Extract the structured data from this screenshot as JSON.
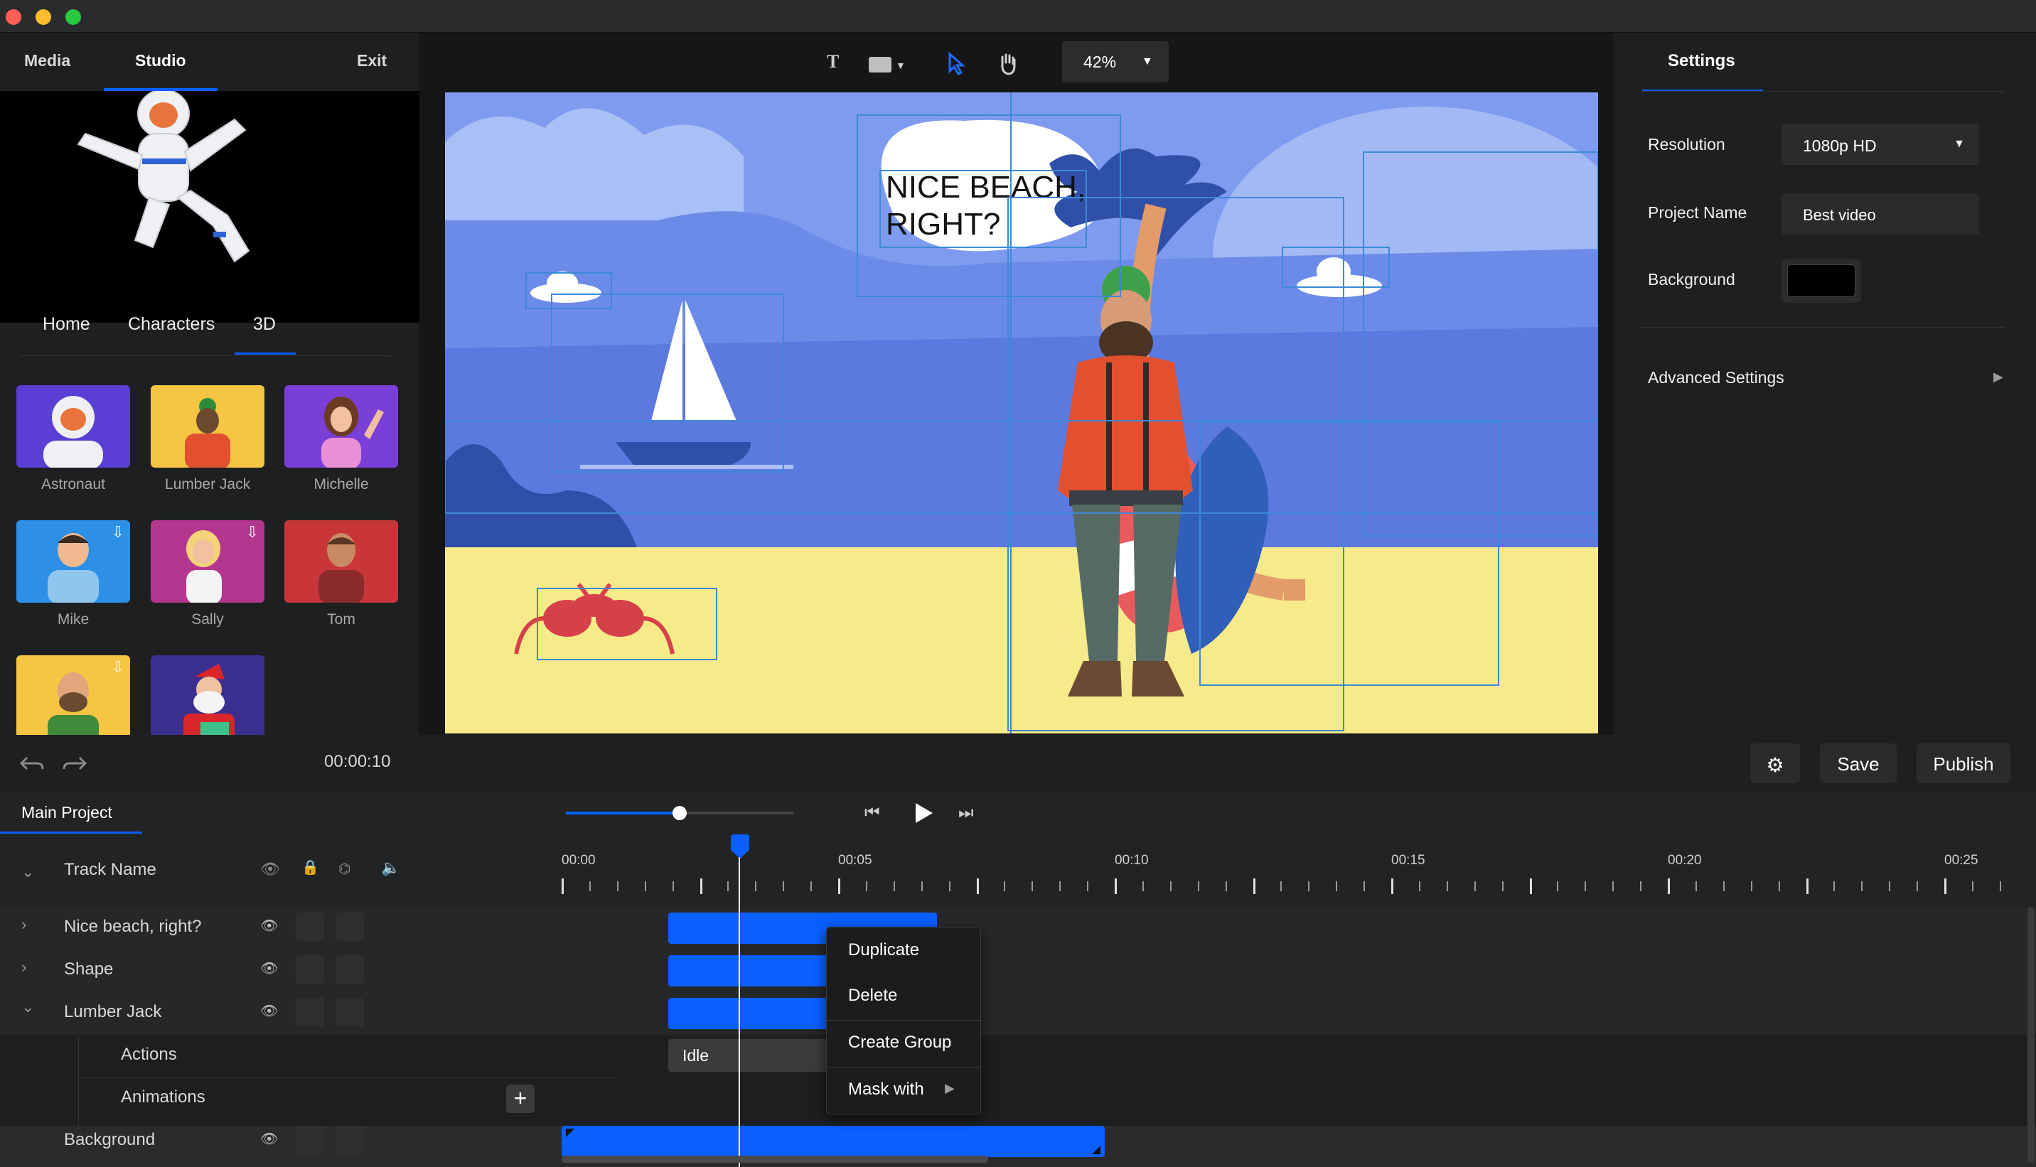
{
  "window": {
    "traffic_lights": [
      "#fe5f57",
      "#febc2e",
      "#28c840"
    ]
  },
  "left_nav": {
    "media": "Media",
    "studio": "Studio",
    "exit": "Exit"
  },
  "library_tabs": [
    "Home",
    "Characters",
    "3D"
  ],
  "characters": [
    {
      "name": "Astronaut",
      "bg": "#5b3fd4",
      "download": false
    },
    {
      "name": "Lumber Jack",
      "bg": "#f6c543",
      "download": false
    },
    {
      "name": "Michelle",
      "bg": "#7a3fd6",
      "download": false
    },
    {
      "name": "Mike",
      "bg": "#2d8fe6",
      "download": true
    },
    {
      "name": "Sally",
      "bg": "#b3368f",
      "download": true
    },
    {
      "name": "Tom",
      "bg": "#c8363a",
      "download": false
    },
    {
      "name": "",
      "bg": "#f6c543",
      "download": true
    },
    {
      "name": "",
      "bg": "#3a2f8f",
      "download": false
    }
  ],
  "download_glyph": "⇩",
  "time_display": "00:00:10",
  "toolbar": {
    "text_tool": "T",
    "zoom": "42%"
  },
  "canvas": {
    "speech": [
      "NICE BEACH,",
      "RIGHT?"
    ]
  },
  "settings": {
    "title": "Settings",
    "resolution_label": "Resolution",
    "resolution_value": "1080p HD",
    "project_name_label": "Project Name",
    "project_name_value": "Best video",
    "background_label": "Background",
    "background_color": "#000000",
    "advanced": "Advanced Settings"
  },
  "actions": {
    "save": "Save",
    "publish": "Publish"
  },
  "timeline": {
    "project_tab": "Main Project",
    "track_header": "Track Name",
    "ruler": [
      "00:00",
      "00:05",
      "00:10",
      "00:15",
      "00:20",
      "00:25"
    ],
    "tracks": [
      "Nice beach, right?",
      "Shape",
      "Lumber Jack",
      "Actions",
      "Animations",
      "Background"
    ],
    "idle_clip": "Idle",
    "playhead_fraction": 0.22
  },
  "context_menu": [
    "Duplicate",
    "Delete",
    "Create Group",
    "Mask with"
  ],
  "accent": "#0a5fff"
}
